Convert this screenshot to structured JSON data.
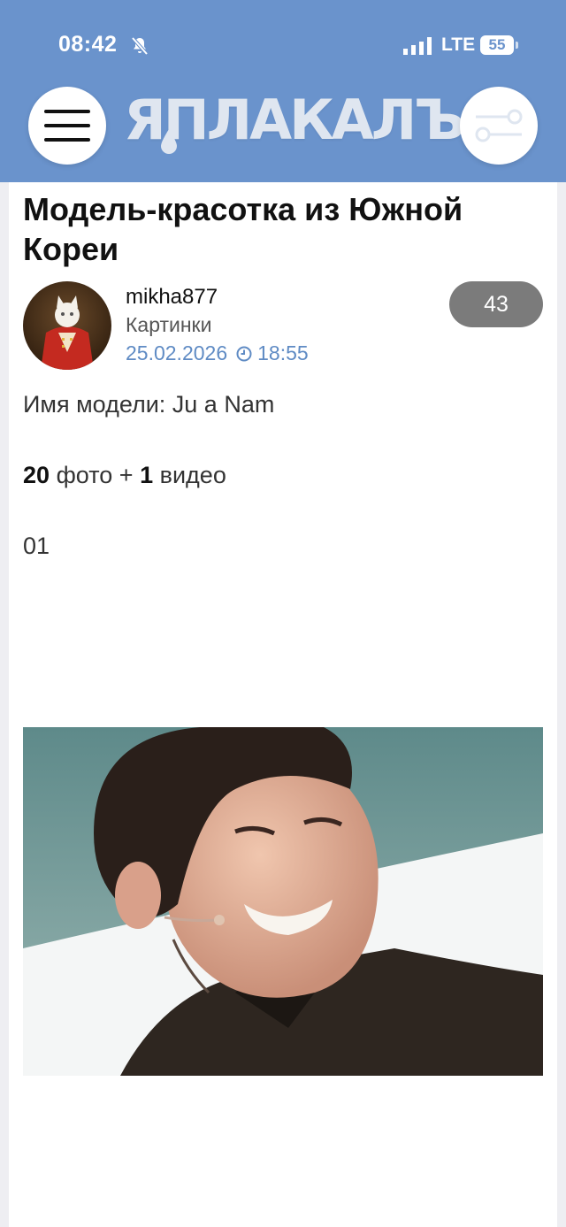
{
  "status_bar": {
    "time": "08:42",
    "network": "LTE",
    "battery": "55"
  },
  "header": {
    "logo_text": "ЯПЛАКАЛЪ",
    "menu_icon": "hamburger-icon",
    "filter_icon": "toggle-sliders-icon"
  },
  "post": {
    "title": "Модель-красотка из Южной Кореи",
    "author": "mikha877",
    "category": "Картинки",
    "date": "25.02.2026",
    "time": "18:55",
    "comments_count": "43",
    "model_line": "Имя модели: Ju a Nam",
    "photo_count": "20",
    "photo_word": "фото +",
    "video_count": "1",
    "video_word": "видео",
    "item_number": "01"
  },
  "colors": {
    "header_bg": "#6a93cc",
    "link_blue": "#5f8bc4",
    "badge_gray": "#7b7b7b"
  }
}
